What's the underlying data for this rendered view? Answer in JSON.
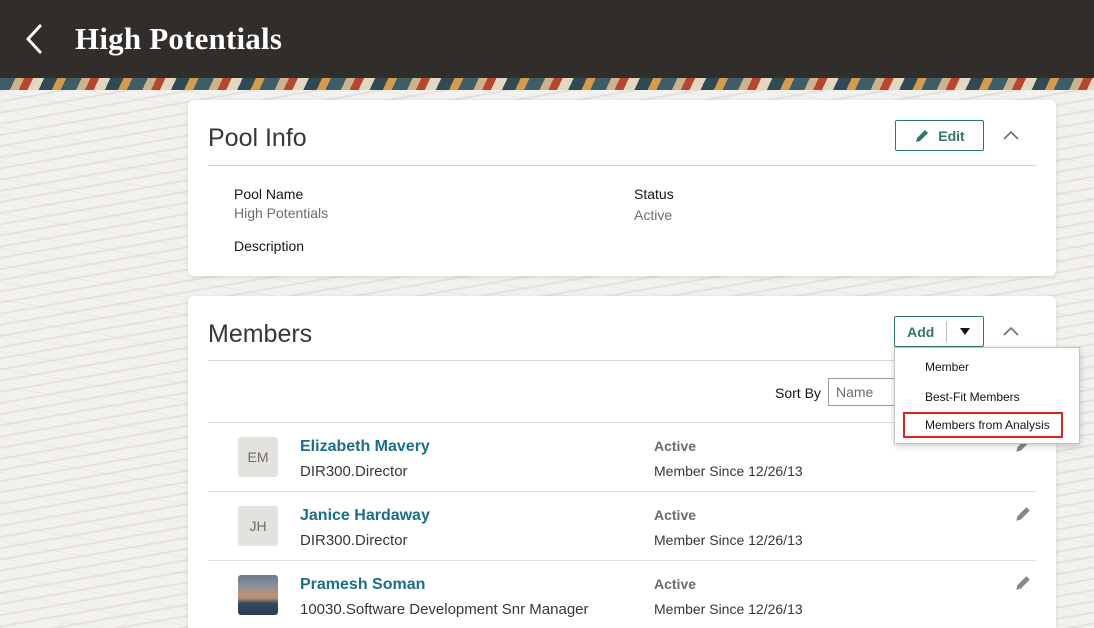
{
  "header": {
    "title": "High Potentials",
    "back_icon": "chevron-left-icon"
  },
  "pool_info": {
    "title": "Pool Info",
    "edit_label": "Edit",
    "fields": {
      "pool_name_label": "Pool Name",
      "pool_name_value": "High Potentials",
      "status_label": "Status",
      "status_value": "Active",
      "description_label": "Description"
    }
  },
  "members": {
    "title": "Members",
    "add_label": "Add",
    "sort_label": "Sort By",
    "sort_value": "Name",
    "rows": [
      {
        "initials": "EM",
        "name": "Elizabeth Mavery",
        "job": "DIR300.Director",
        "status": "Active",
        "since": "Member Since 12/26/13"
      },
      {
        "initials": "JH",
        "name": "Janice Hardaway",
        "job": "DIR300.Director",
        "status": "Active",
        "since": "Member Since 12/26/13"
      },
      {
        "initials": "",
        "name": "Pramesh Soman",
        "job": "10030.Software Development Snr Manager",
        "status": "Active",
        "since": "Member Since 12/26/13"
      }
    ]
  },
  "add_menu": {
    "items": [
      "Member",
      "Best-Fit Members",
      "Members from Analysis"
    ]
  },
  "colors": {
    "header_bg": "#312d2a",
    "accent_green": "#2f7a5a",
    "link_blue": "#1b6e8b",
    "highlight_red": "#e0211c"
  }
}
